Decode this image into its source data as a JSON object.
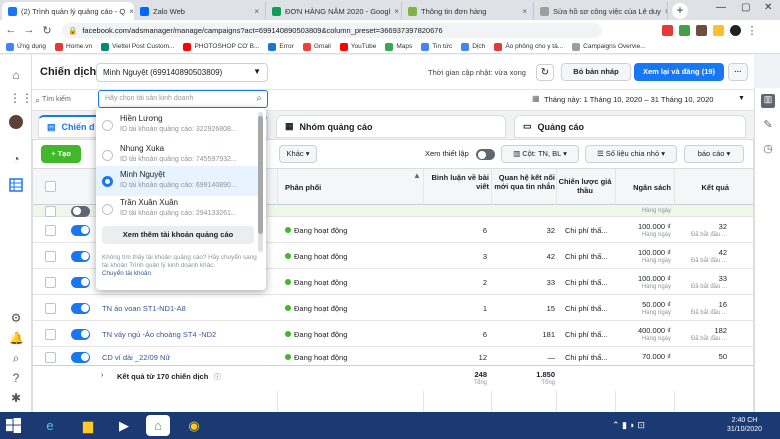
{
  "browser": {
    "tabs": [
      {
        "title": "(2) Trình quản lý quảng cáo - Q",
        "color": "#1877f2",
        "active": true
      },
      {
        "title": "Zalo Web",
        "color": "#0068ff"
      },
      {
        "title": "ĐƠN HÀNG NĂM 2020 - Googl",
        "color": "#0f9d58"
      },
      {
        "title": "Thông tin đơn hàng",
        "color": "#7cb342"
      },
      {
        "title": "Sửa hồ sơ công việc của Lê duy",
        "color": "#9e9e9e"
      }
    ],
    "new_tab": "+",
    "url": "facebook.com/adsmanager/manage/campaigns?act=699140890503809&column_preset=366937397820676",
    "bookmarks": [
      "Ứng dụng",
      "Home.vn",
      "Viettel Post Custom...",
      "PHOTOSHOP CƠ B...",
      "Error",
      "Gmail",
      "YouTube",
      "Maps",
      "Tin tức",
      "Dịch",
      "Áo phông cho y tá...",
      "Campaigns Overvie..."
    ]
  },
  "header": {
    "title": "Chiến dịch",
    "account_selected": "Minh Nguyệt (699140890503809)",
    "update_time": "Thời gian cập nhật: vừa xong",
    "discard_drafts": "Bỏ bản nháp",
    "review_publish": "Xem lại và đăng (19)",
    "more": "···"
  },
  "search": {
    "label": "Tìm kiếm",
    "placeholder": "Hãy chọn tài sản kinh doanh",
    "date_range": "Tháng này: 1 Tháng 10, 2020 – 31 Tháng 10, 2020"
  },
  "level_tabs": [
    {
      "label": "Chiến d"
    },
    {
      "label": "Nhóm quảng cáo"
    },
    {
      "label": "Quảng cáo"
    }
  ],
  "toolbar": {
    "create": "Tạo",
    "more": "Khác",
    "view_setup": "Xem thiết lập",
    "columns": "Cột: TN, BL",
    "breakdown": "Số liệu chia nhỏ",
    "reports": "báo cáo"
  },
  "dropdown": {
    "accounts": [
      {
        "name": "Hiền Lương",
        "id": "ID tài khoản quảng cáo: 322926808..."
      },
      {
        "name": "Nhung Xuka",
        "id": "ID tài khoản quảng cáo: 745597932..."
      },
      {
        "name": "Minh Nguyệt",
        "id": "ID tài khoản quảng cáo: 699140890...",
        "selected": true
      },
      {
        "name": "Trần Xuân Xuân",
        "id": "ID tài khoản quảng cáo: 294133261..."
      }
    ],
    "see_more": "Xem thêm tài khoản quảng cáo",
    "note": "Không tìm thấy tài khoản quảng cáo? Hãy chuyển sang tài khoản Trình quản lý kinh doanh khác.",
    "switch_link": "Chuyển tài khoản"
  },
  "table": {
    "columns": {
      "delivery": "Phân phối",
      "comments": "Bình luận về bài viết",
      "messages": "Quan hệ kết nối mới qua tin nhắn",
      "strategy": "Chiến lược giá thầu",
      "budget": "Ngân sách",
      "results": "Kết quả"
    },
    "rows": [
      {
        "name": "",
        "delivery": "",
        "comments": "",
        "messages": "",
        "strategy": "",
        "budget": "",
        "budget_sub": "Hàng ngày",
        "result": "",
        "result_sub": "",
        "toggle": false
      },
      {
        "name": "",
        "delivery": "Đang hoạt động",
        "comments": "6",
        "messages": "32",
        "strategy": "Chi phí thấ...",
        "budget": "100.000 ₫",
        "budget_sub": "Hàng ngày",
        "result": "32",
        "result_sub": "Đã bắt đầu ...",
        "toggle": true
      },
      {
        "name": "",
        "delivery": "Đang hoạt động",
        "comments": "3",
        "messages": "42",
        "strategy": "Chi phí thấ...",
        "budget": "100.000 ₫",
        "budget_sub": "Hàng ngày",
        "result": "42",
        "result_sub": "Đã bắt đầu ...",
        "toggle": true
      },
      {
        "name": "",
        "delivery": "Đang hoạt động",
        "comments": "2",
        "messages": "33",
        "strategy": "Chi phí thấ...",
        "budget": "100.000 ₫",
        "budget_sub": "Hàng ngày",
        "result": "33",
        "result_sub": "Đã bắt đầu ...",
        "toggle": true
      },
      {
        "name": "TN áo voan ST1-ND1-A8",
        "delivery": "Đang hoạt động",
        "comments": "1",
        "messages": "15",
        "strategy": "Chi phí thấ...",
        "budget": "50.000 ₫",
        "budget_sub": "Hàng ngày",
        "result": "16",
        "result_sub": "Đã bắt đầu ...",
        "toggle": true
      },
      {
        "name": "TN váy ngủ -Áo choàng ST4 -ND2",
        "delivery": "Đang hoạt động",
        "comments": "6",
        "messages": "181",
        "strategy": "Chi phí thấ...",
        "budget": "400.000 ₫",
        "budget_sub": "Hàng ngày",
        "result": "182",
        "result_sub": "Đã bắt đầu ...",
        "toggle": true
      },
      {
        "name": "CD ví dài _22/09 Nữ",
        "delivery": "Đang hoạt động",
        "comments": "12",
        "messages": "—",
        "strategy": "Chi phí thấ...",
        "budget": "70.000 ₫",
        "budget_sub": "",
        "result": "50",
        "result_sub": "",
        "toggle": true
      }
    ],
    "totals": {
      "label": "Kết quả từ 170 chiến dịch",
      "comments": "248",
      "comments_sub": "Tổng",
      "messages": "1.850",
      "messages_sub": "Tổng"
    }
  },
  "taskbar": {
    "time": "2:40 CH",
    "date": "31/10/2020"
  },
  "colors": {
    "accent": "#1877f2",
    "green": "#42b72a",
    "taskbar": "#1b3a73"
  }
}
